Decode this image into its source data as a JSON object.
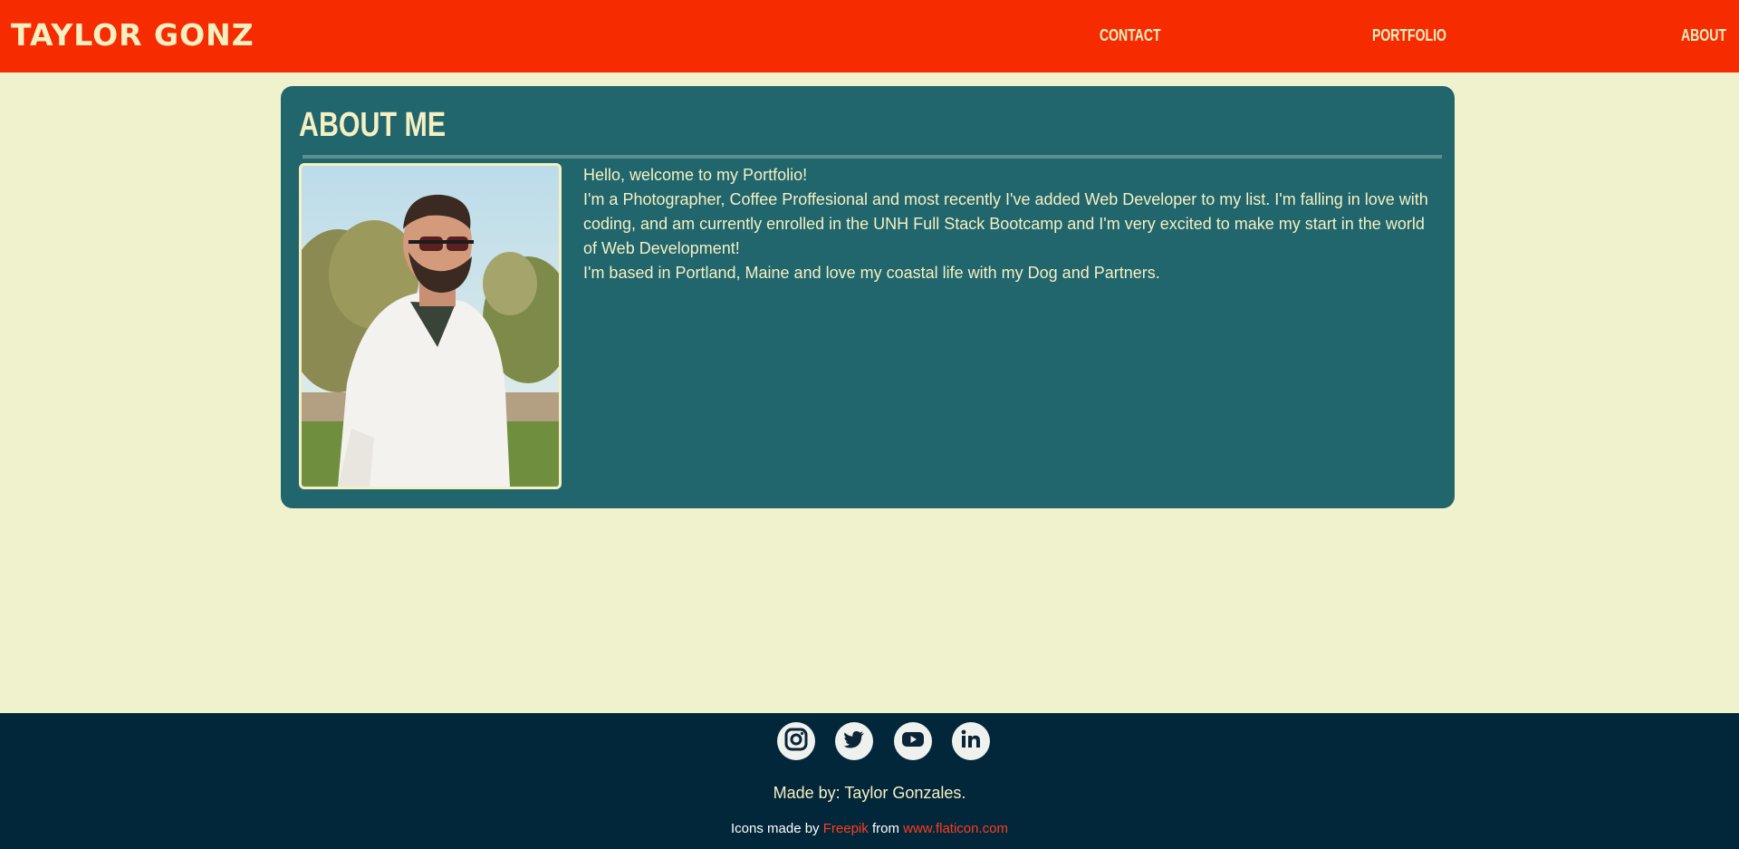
{
  "header": {
    "brand": "TAYLOR GONZ",
    "nav": {
      "contact": "CONTACT",
      "portfolio": "PORTFOLIO",
      "about": "ABOUT"
    }
  },
  "about": {
    "title": "ABOUT ME",
    "photo_subject": "portrait of man in sunglasses and white shirt",
    "paragraphs": [
      "Hello, welcome to my Portfolio!",
      "I'm a Photographer, Coffee Proffesional and most recently I've added Web Developer to my list. I'm falling in love with coding, and am currently enrolled in the UNH Full Stack Bootcamp and I'm very excited to make my start in the world of Web Development!",
      "I'm based in Portland, Maine and love my coastal life with my Dog and Partners."
    ]
  },
  "footer": {
    "socials": [
      {
        "icon": "instagram-icon"
      },
      {
        "icon": "twitter-icon"
      },
      {
        "icon": "youtube-icon"
      },
      {
        "icon": "linkedin-icon"
      }
    ],
    "made_by": "Made by: Taylor Gonzales.",
    "credits": {
      "prefix": "Icons made by",
      "author": "Freepik",
      "middle": "from",
      "site": "www.flaticon.com"
    }
  },
  "colors": {
    "header_bg": "#f72b00",
    "page_bg": "#f0f2cd",
    "card_bg": "#21656d",
    "footer_bg": "#03273a",
    "text_cream": "#f5f0c2",
    "link_red": "#ff3b1f"
  }
}
